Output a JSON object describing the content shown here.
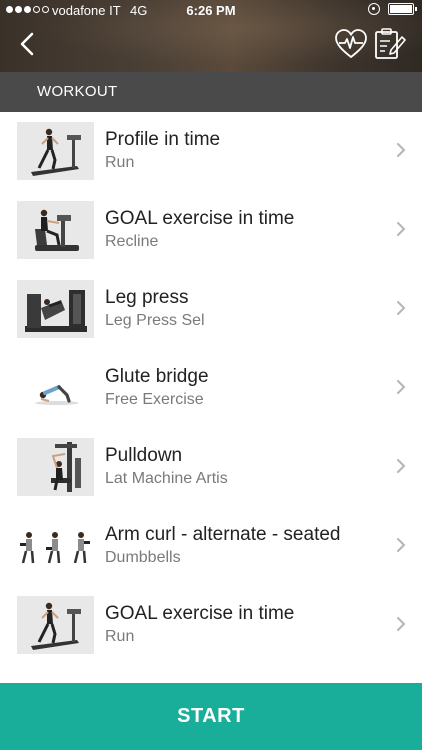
{
  "status_bar": {
    "carrier": "vodafone IT",
    "network": "4G",
    "time": "6:26 PM"
  },
  "nav": {
    "icons": [
      "back-chevron-icon",
      "heart-rate-icon",
      "clipboard-edit-icon"
    ]
  },
  "section": {
    "title": "WORKOUT"
  },
  "exercises": [
    {
      "title": "Profile in time",
      "subtitle": "Run",
      "image": "treadmill-runner"
    },
    {
      "title": "GOAL exercise in time",
      "subtitle": "Recline",
      "image": "recline-bike"
    },
    {
      "title": "Leg press",
      "subtitle": "Leg Press Sel",
      "image": "leg-press-machine"
    },
    {
      "title": "Glute bridge",
      "subtitle": "Free Exercise",
      "image": "glute-bridge-person"
    },
    {
      "title": "Pulldown",
      "subtitle": "Lat Machine Artis",
      "image": "lat-pulldown-machine"
    },
    {
      "title": "Arm curl - alternate - seated",
      "subtitle": "Dumbbells",
      "image": "seated-curl-sequence"
    },
    {
      "title": "GOAL exercise in time",
      "subtitle": "Run",
      "image": "treadmill-runner"
    }
  ],
  "footer": {
    "start_label": "START"
  },
  "colors": {
    "accent": "#18ae9a",
    "section_bar": "#4a4a4a"
  }
}
